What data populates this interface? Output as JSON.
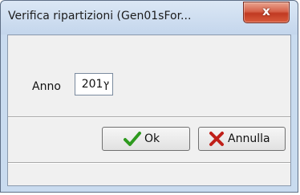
{
  "window": {
    "title": "Verifica ripartizioni  (Gen01sFor...",
    "close_symbol": "x"
  },
  "form": {
    "anno_label": "Anno",
    "anno_value": "201ץ"
  },
  "buttons": {
    "ok_label": "Ok",
    "cancel_label": "Annulla"
  },
  "icons": {
    "ok": "checkmark-icon",
    "cancel": "x-icon",
    "close": "close-icon"
  },
  "colors": {
    "close_button": "#c8432b",
    "check_green": "#2e9a1f",
    "cancel_red": "#c0201a"
  }
}
